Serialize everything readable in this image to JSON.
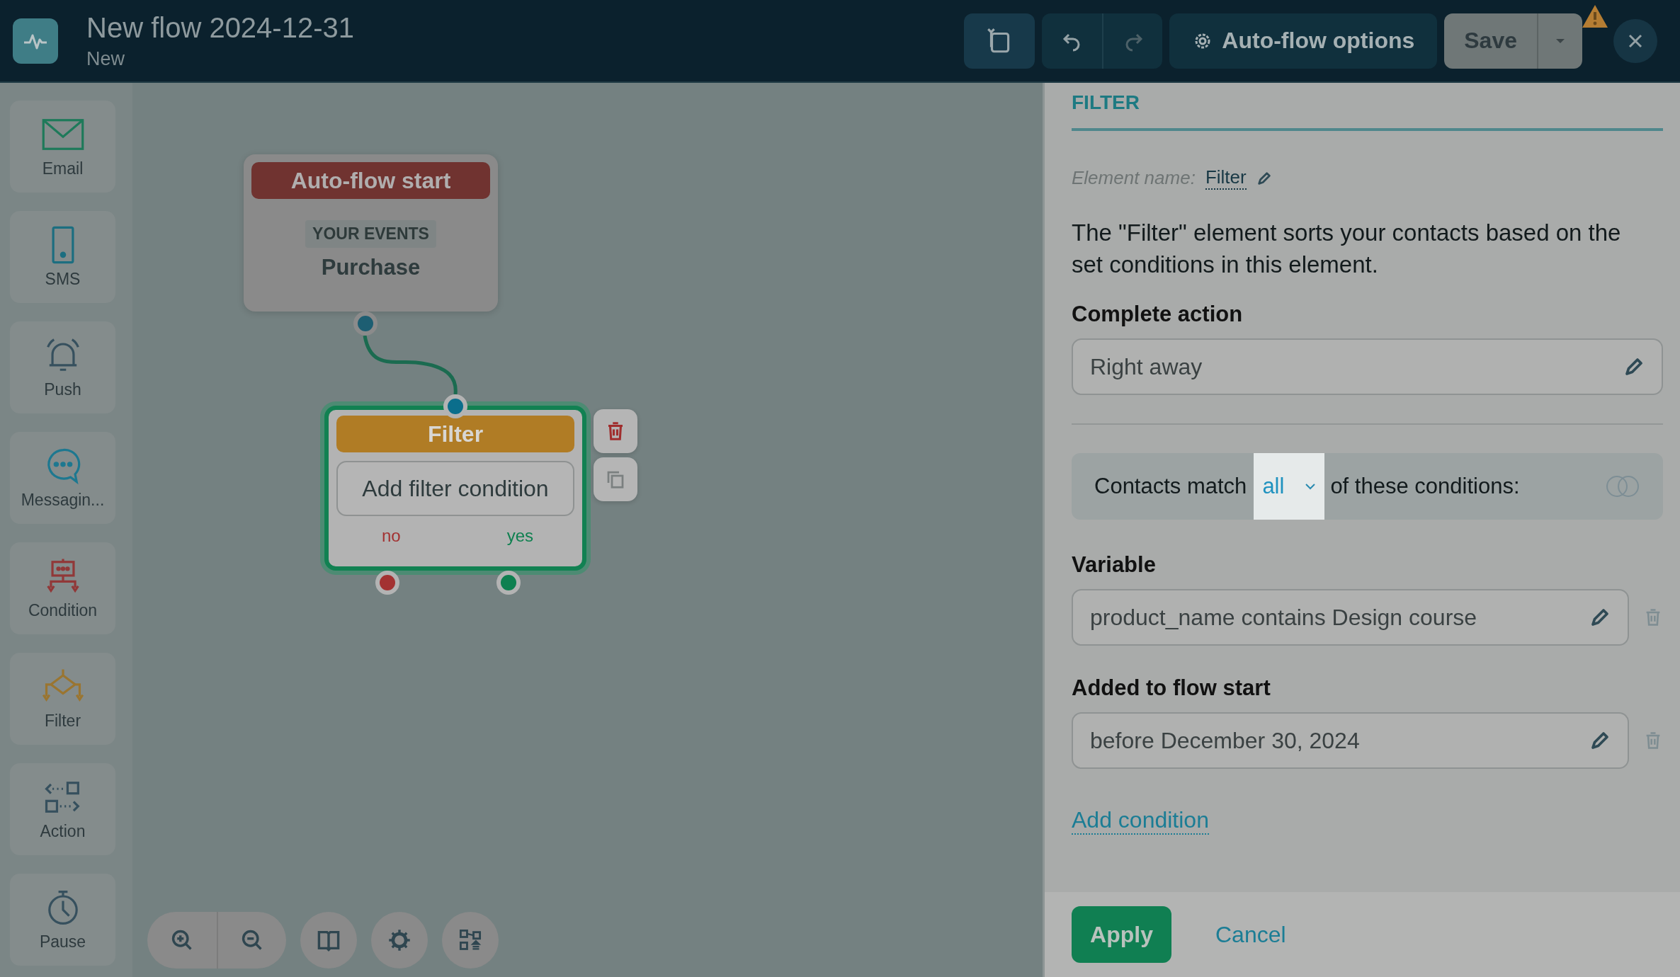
{
  "header": {
    "title": "New flow 2024-12-31",
    "subtitle": "New",
    "options_button": "Auto-flow options",
    "save_button": "Save",
    "warning": true
  },
  "sidebar": {
    "items": [
      {
        "kind": "email",
        "label": "Email",
        "color": "#1e7a5a"
      },
      {
        "kind": "sms",
        "label": "SMS",
        "color": "#1c6e80"
      },
      {
        "kind": "push",
        "label": "Push",
        "color": "#36505e"
      },
      {
        "kind": "messaging",
        "label": "Messagin...",
        "color": "#1d7890"
      },
      {
        "kind": "condition",
        "label": "Condition",
        "color": "#913838"
      },
      {
        "kind": "filter",
        "label": "Filter",
        "color": "#9a7530"
      },
      {
        "kind": "action",
        "label": "Action",
        "color": "#36505e"
      },
      {
        "kind": "pause",
        "label": "Pause",
        "color": "#36505e"
      }
    ]
  },
  "canvas": {
    "nodes": [
      {
        "kind": "start",
        "selected": false,
        "title": "Auto-flow start",
        "tag": "YOUR EVENTS",
        "event": "Purchase"
      },
      {
        "kind": "filter",
        "selected": true,
        "title": "Filter",
        "button": "Add filter condition",
        "branches": [
          {
            "label": "no",
            "color": "#a33232"
          },
          {
            "label": "yes",
            "color": "#0f8050"
          }
        ]
      }
    ]
  },
  "panel": {
    "section_title": "FILTER",
    "element_name": {
      "label": "Element name:",
      "value": "Filter"
    },
    "description": "The \"Filter\" element sorts your contacts based on the set conditions in this element.",
    "complete_action": {
      "label": "Complete action",
      "value": "Right away"
    },
    "match": {
      "prefix": "Contacts match",
      "value": "all",
      "suffix": "of these conditions:"
    },
    "conditions": [
      {
        "label": "Variable",
        "value": "product_name contains Design course"
      },
      {
        "label": "Added to flow start",
        "value": "before December 30, 2024"
      }
    ],
    "add_condition": "Add condition",
    "apply_button": "Apply",
    "cancel_button": "Cancel"
  }
}
